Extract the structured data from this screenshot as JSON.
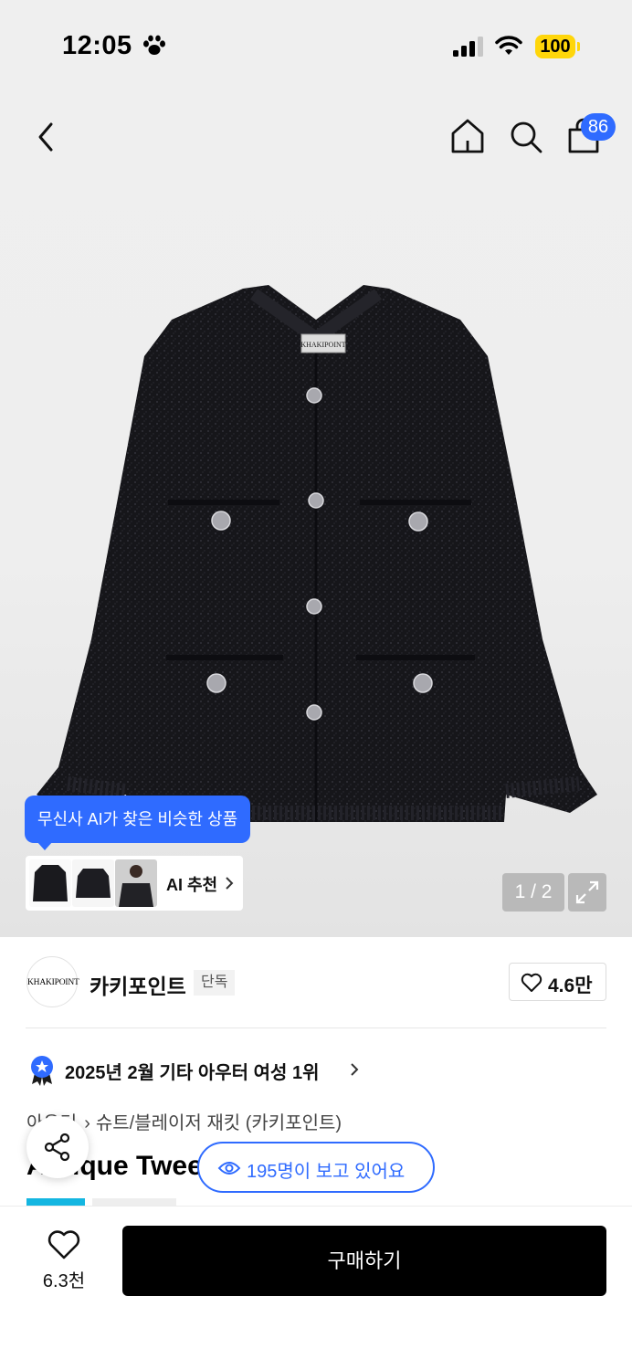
{
  "status_bar": {
    "time": "12:05",
    "battery": "100",
    "icons": [
      "paw-icon",
      "signal-icon",
      "wifi-icon"
    ]
  },
  "header": {
    "cart_count": "86",
    "icons": [
      "back-icon",
      "home-icon",
      "search-icon",
      "cart-icon"
    ]
  },
  "gallery": {
    "ai_tooltip": "무신사 AI가 찾은 비슷한 상품",
    "ai_recommend_label": "AI 추천",
    "page_counter": "1 / 2",
    "logo_label": "KHAKIPOINT"
  },
  "brand": {
    "logo_text": "KHAKIPOINT",
    "name": "카키포인트",
    "tag": "단독",
    "like_count": "4.6만"
  },
  "ranking": {
    "text": "2025년 2월 기타 아우터 여성 1위"
  },
  "breadcrumb": {
    "category": "아우터",
    "subcategory": "슈트/블레이저 재킷 (카키포인트)"
  },
  "product": {
    "title": "Antique Tweed"
  },
  "viewers": {
    "text": "195명이 보고 있어요"
  },
  "bottom_bar": {
    "wish_count": "6.3천",
    "buy_label": "구매하기"
  },
  "colors": {
    "accent": "#2f6bff",
    "battery": "#ffd60a",
    "badge": "#14b6e1"
  }
}
